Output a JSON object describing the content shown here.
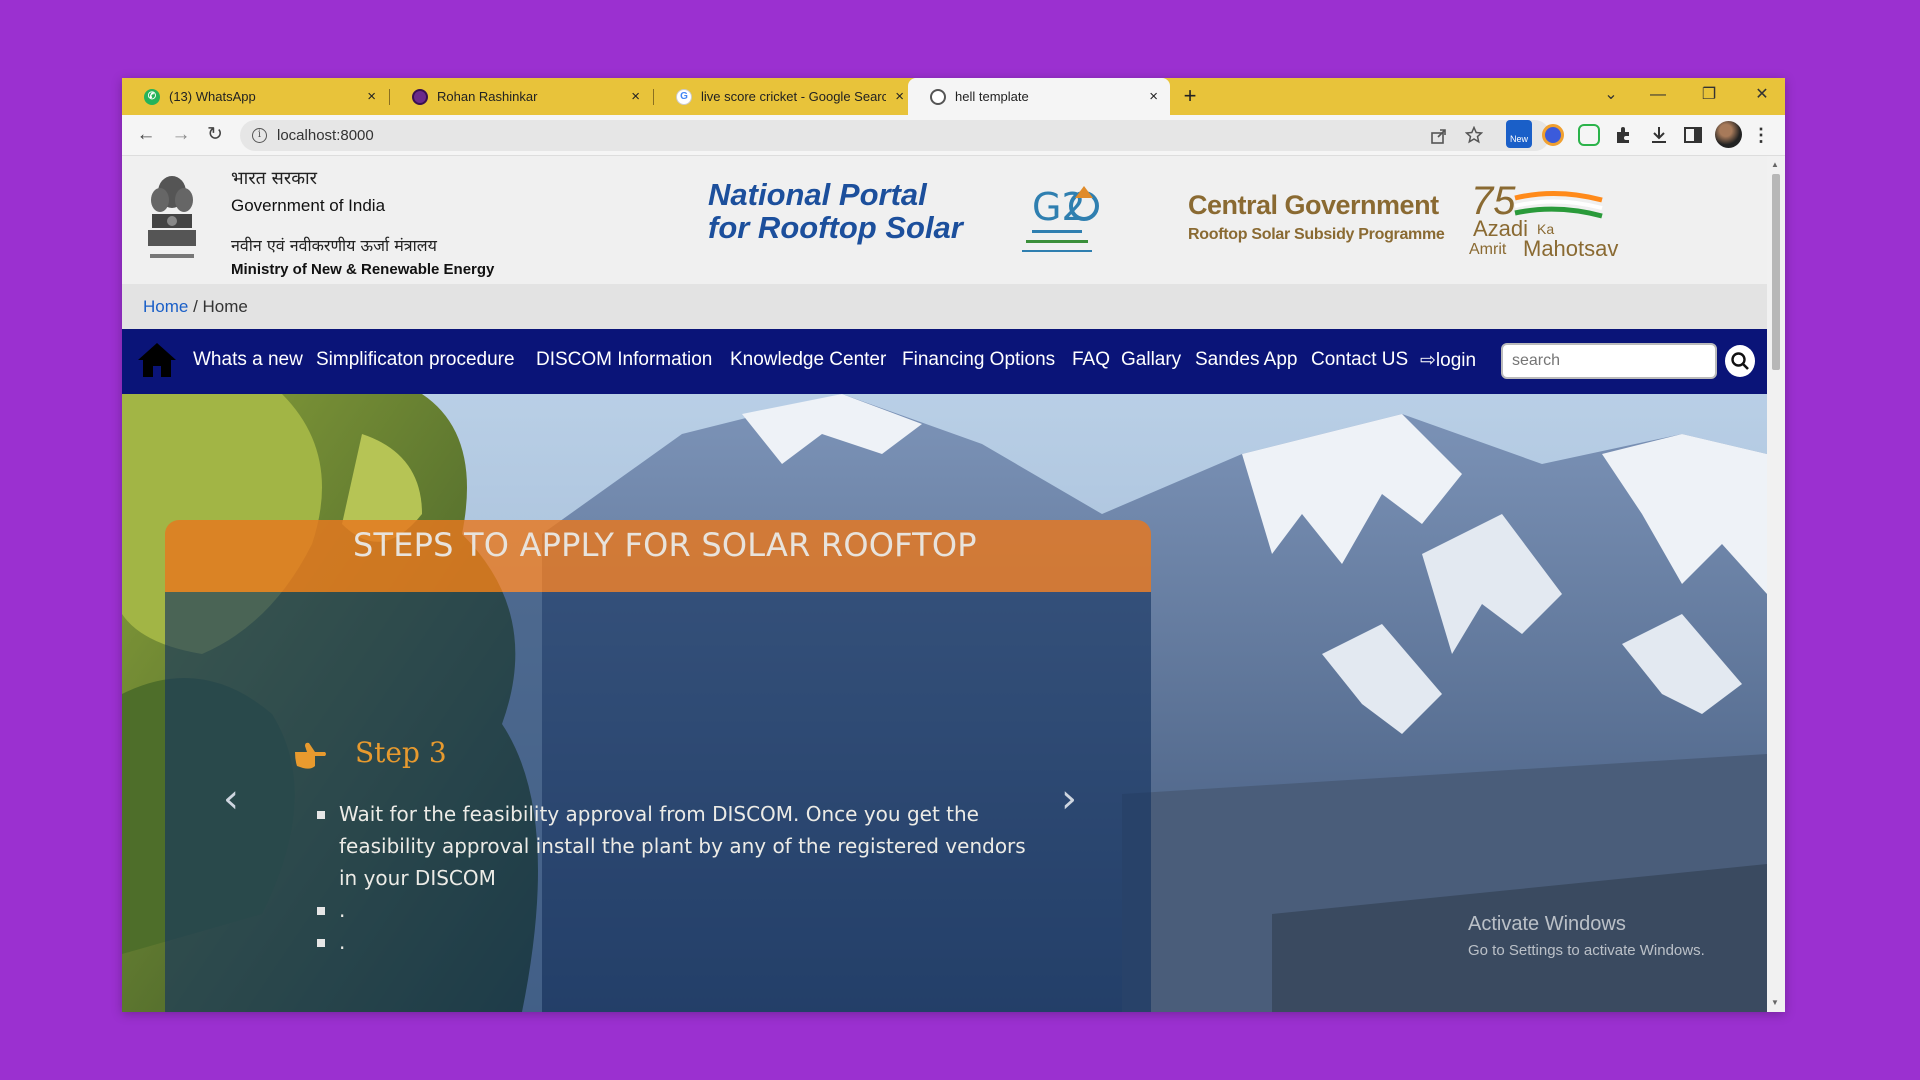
{
  "tabs": [
    {
      "title": "(13) WhatsApp",
      "favicon": "whatsapp-icon",
      "active": false
    },
    {
      "title": "Rohan Rashinkar",
      "favicon": "profile-icon",
      "active": false
    },
    {
      "title": "live score cricket - Google Search",
      "favicon": "google-icon",
      "active": false
    },
    {
      "title": "hell template",
      "favicon": "globe-icon",
      "active": true
    }
  ],
  "tab_close": "×",
  "new_tab": "+",
  "window_controls": {
    "dropdown": "⌄",
    "minimize": "—",
    "restore": "❐",
    "close": "✕"
  },
  "toolbar": {
    "back": "←",
    "forward": "→",
    "reload": "↻",
    "info": "i",
    "url": "localhost:8000",
    "ext_badge": "New"
  },
  "header": {
    "gov_hindi": "भारत सरकार",
    "gov_english": "Government of India",
    "ministry_hindi": "नवीन एवं नवीकरणीय ऊर्जा मंत्रालय",
    "ministry_english": "Ministry of New & Renewable Energy",
    "portal_line1": "National Portal",
    "portal_line2": "for Rooftop Solar",
    "cg_title": "Central Government",
    "cg_subtitle": "Rooftop Solar Subsidy Programme"
  },
  "breadcrumb": {
    "link": "Home",
    "sep": " / ",
    "current": "Home"
  },
  "nav": {
    "items": [
      "Whats a new",
      "Simplificaton procedure",
      "DISCOM Information",
      "Knowledge Center",
      "Financing Options",
      "FAQ",
      "Gallary",
      "Sandes App",
      "Contact US",
      "login"
    ],
    "login_icon": "⇨",
    "search_placeholder": "search"
  },
  "hero": {
    "panel_title": "STEPS TO APPLY FOR SOLAR ROOFTOP",
    "step_title": "Step 3",
    "step_items": [
      "Wait for the feasibility approval from DISCOM. Once you get the feasibility approval install the plant by any of the registered vendors in your DISCOM",
      ".",
      "."
    ],
    "prev": "‹",
    "next": "›"
  },
  "watermark": {
    "line1": "Activate Windows",
    "line2": "Go to Settings to activate Windows."
  },
  "colors": {
    "tabstrip": "#e8c33a",
    "nav": "#0a1478",
    "panel_head": "#e6781e",
    "step_title": "#e89a2e",
    "page_bg": "#9b30d0"
  }
}
